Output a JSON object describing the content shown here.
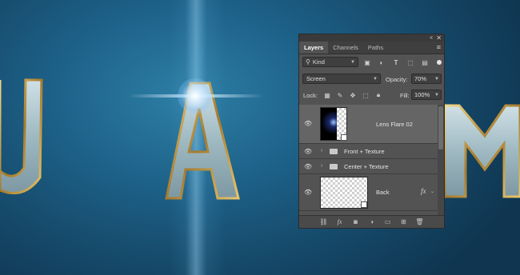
{
  "panel": {
    "collapse_icon": "collapse-arrows-icon",
    "close_icon": "close-icon",
    "tabs": [
      {
        "label": "Layers",
        "active": true
      },
      {
        "label": "Channels",
        "active": false
      },
      {
        "label": "Paths",
        "active": false
      }
    ],
    "menu_icon": "panel-menu-icon"
  },
  "filter": {
    "kind_label": "Kind",
    "icons": [
      "pixel-filter-icon",
      "adjustment-filter-icon",
      "type-filter-icon",
      "shape-filter-icon",
      "smart-object-filter-icon"
    ]
  },
  "blend": {
    "mode": "Screen",
    "opacity_label": "Opacity:",
    "opacity_value": "70%"
  },
  "lock": {
    "label": "Lock:",
    "fill_label": "Fill:",
    "fill_value": "100%"
  },
  "layers": [
    {
      "name": "Lens Flare 02",
      "type": "smart-object",
      "selected": true
    },
    {
      "name": "Front + Texture",
      "type": "group",
      "selected": false
    },
    {
      "name": "Center + Texture",
      "type": "group",
      "selected": false
    },
    {
      "name": "Back",
      "type": "smart-object",
      "selected": false,
      "fx": "fx"
    }
  ],
  "bottom_icons": [
    "link-icon",
    "fx-icon",
    "mask-icon",
    "adjustment-icon",
    "folder-icon",
    "new-layer-icon",
    "trash-icon"
  ],
  "colors": {
    "panel_bg": "#535353",
    "selected_row": "#656565",
    "canvas_blue": "#1d6087"
  }
}
